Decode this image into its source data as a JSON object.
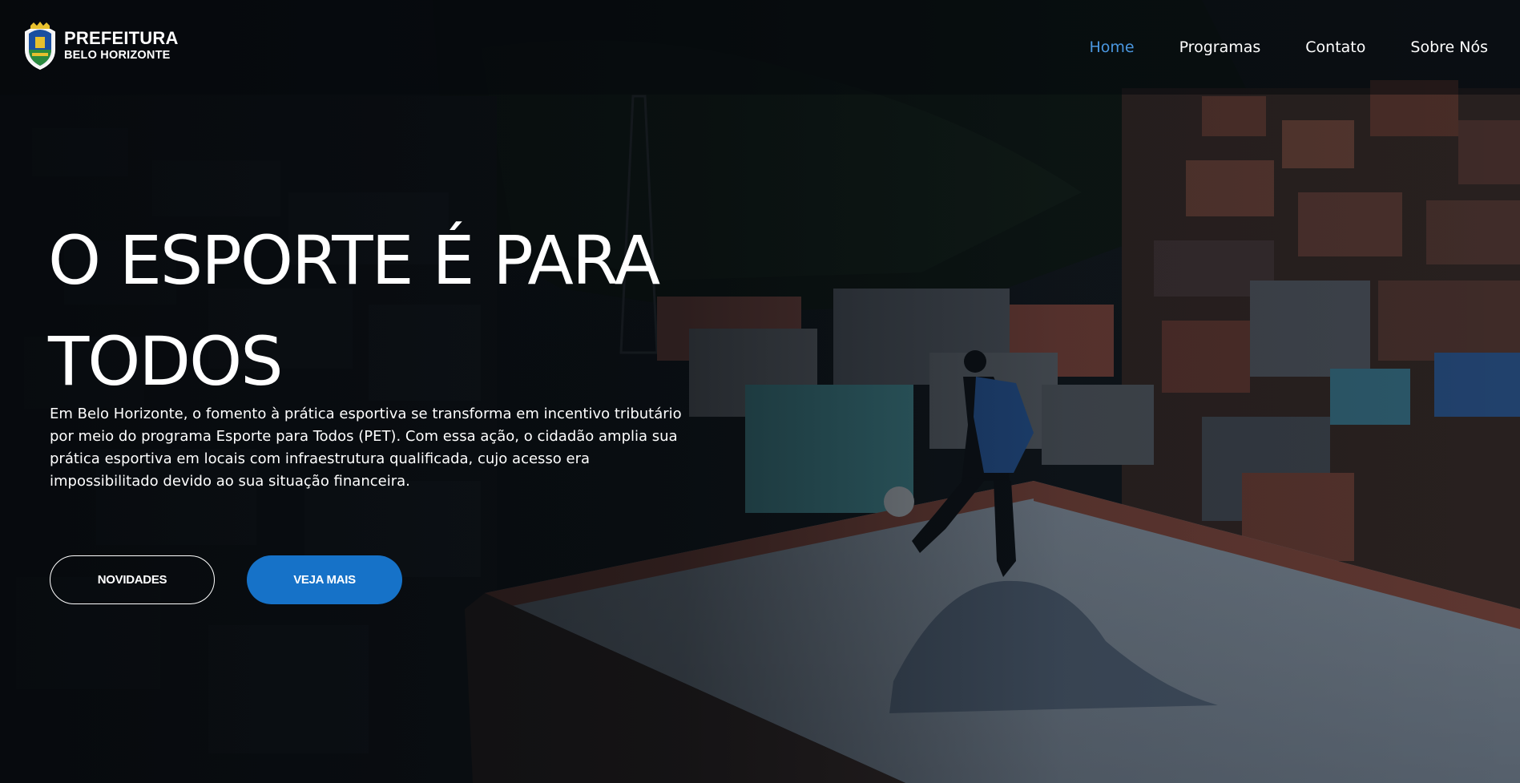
{
  "header": {
    "logo": {
      "line1": "PREFEITURA",
      "line2": "BELO HORIZONTE"
    },
    "nav": [
      {
        "label": "Home",
        "active": true
      },
      {
        "label": "Programas",
        "active": false
      },
      {
        "label": "Contato",
        "active": false
      },
      {
        "label": "Sobre Nós",
        "active": false
      }
    ]
  },
  "hero": {
    "headline": "O ESPORTE É PARA TODOS",
    "lead": "Em Belo Horizonte, o fomento à prática esportiva se transforma em incentivo tributário por meio do programa Esporte para Todos (PET). Com essa ação, o cidadão amplia sua prática esportiva em locais com infraestrutura qualificada, cujo acesso era impossibilitado devido ao sua situação financeira.",
    "buttons": {
      "secondary_label": "NOVIDADES",
      "primary_label": "VEJA MAIS"
    }
  },
  "colors": {
    "accent": "#1672c8",
    "nav_active": "#4a97e0",
    "overlay": "#0c1118"
  }
}
